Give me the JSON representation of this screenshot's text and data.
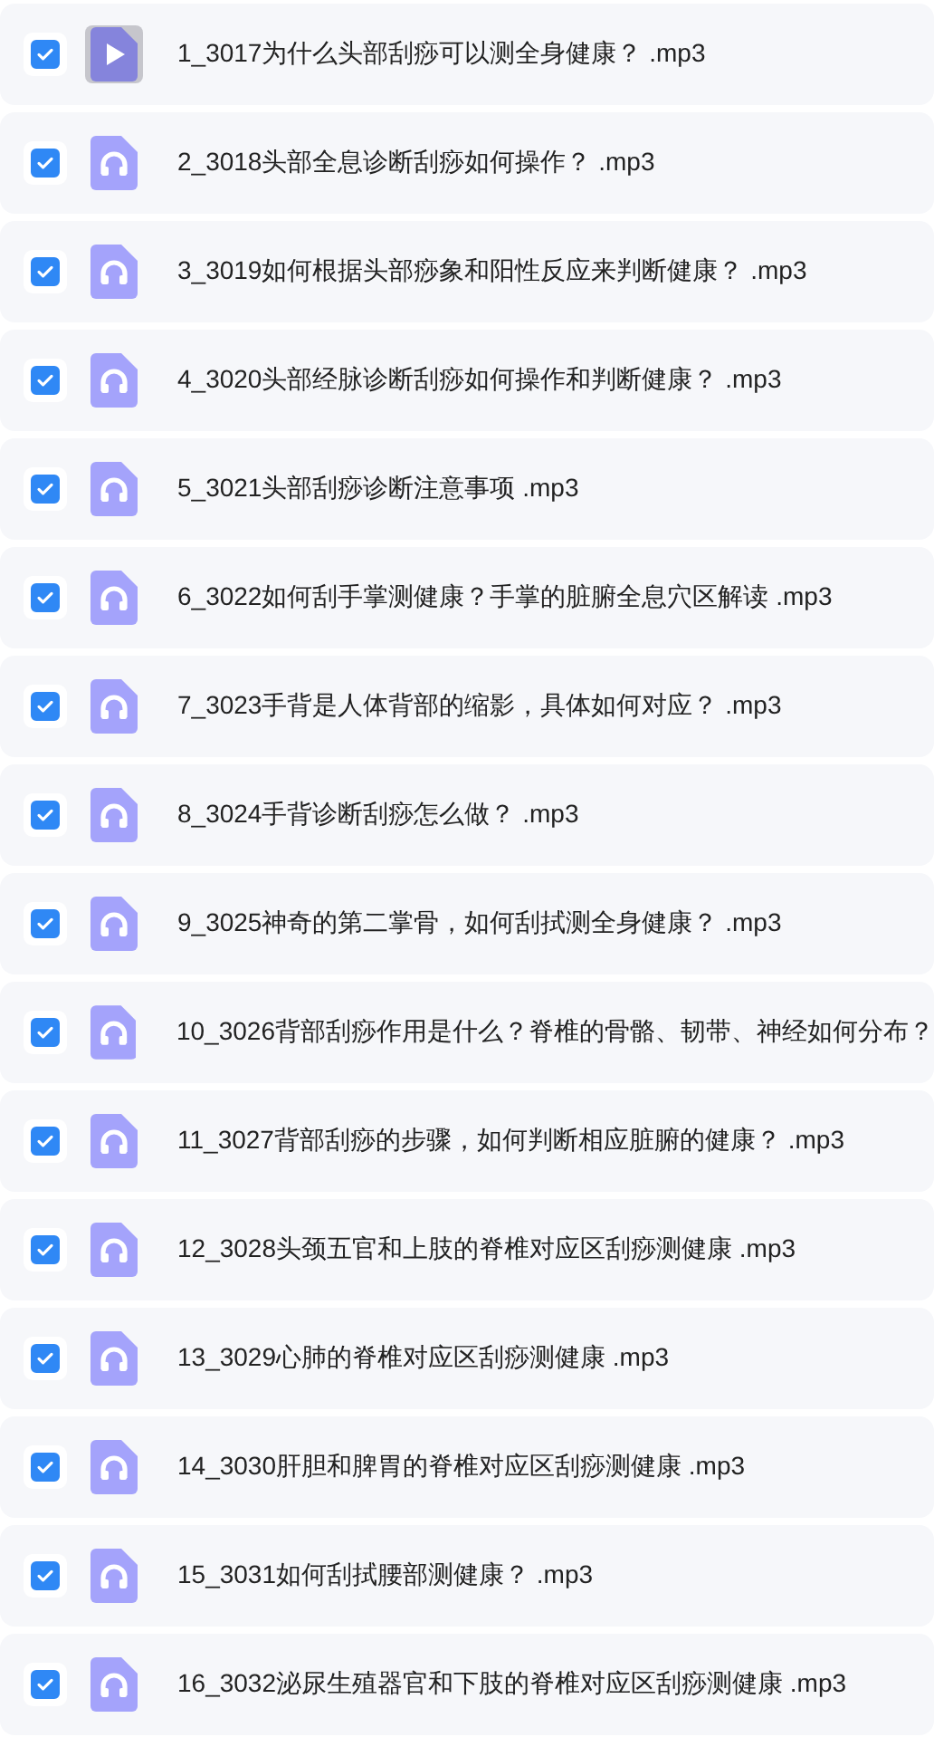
{
  "files": [
    {
      "name": "1_3017为什么头部刮痧可以测全身健康？ .mp3",
      "checked": true,
      "selected": true
    },
    {
      "name": "2_3018头部全息诊断刮痧如何操作？ .mp3",
      "checked": true,
      "selected": false
    },
    {
      "name": "3_3019如何根据头部痧象和阳性反应来判断健康？ .mp3",
      "checked": true,
      "selected": false
    },
    {
      "name": "4_3020头部经脉诊断刮痧如何操作和判断健康？ .mp3",
      "checked": true,
      "selected": false
    },
    {
      "name": "5_3021头部刮痧诊断注意事项 .mp3",
      "checked": true,
      "selected": false
    },
    {
      "name": "6_3022如何刮手掌测健康？手掌的脏腑全息穴区解读 .mp3",
      "checked": true,
      "selected": false
    },
    {
      "name": "7_3023手背是人体背部的缩影，具体如何对应？ .mp3",
      "checked": true,
      "selected": false
    },
    {
      "name": "8_3024手背诊断刮痧怎么做？ .mp3",
      "checked": true,
      "selected": false
    },
    {
      "name": "9_3025神奇的第二掌骨，如何刮拭测全身健康？ .mp3",
      "checked": true,
      "selected": false
    },
    {
      "name": "10_3026背部刮痧作用是什么？脊椎的骨骼、韧带、神经如何分布？",
      "checked": true,
      "selected": false
    },
    {
      "name": "11_3027背部刮痧的步骤，如何判断相应脏腑的健康？ .mp3",
      "checked": true,
      "selected": false
    },
    {
      "name": "12_3028头颈五官和上肢的脊椎对应区刮痧测健康 .mp3",
      "checked": true,
      "selected": false
    },
    {
      "name": "13_3029心肺的脊椎对应区刮痧测健康 .mp3",
      "checked": true,
      "selected": false
    },
    {
      "name": "14_3030肝胆和脾胃的脊椎对应区刮痧测健康 .mp3",
      "checked": true,
      "selected": false
    },
    {
      "name": "15_3031如何刮拭腰部测健康？ .mp3",
      "checked": true,
      "selected": false
    },
    {
      "name": "16_3032泌尿生殖器官和下肢的脊椎对应区刮痧测健康 .mp3",
      "checked": true,
      "selected": false
    }
  ]
}
